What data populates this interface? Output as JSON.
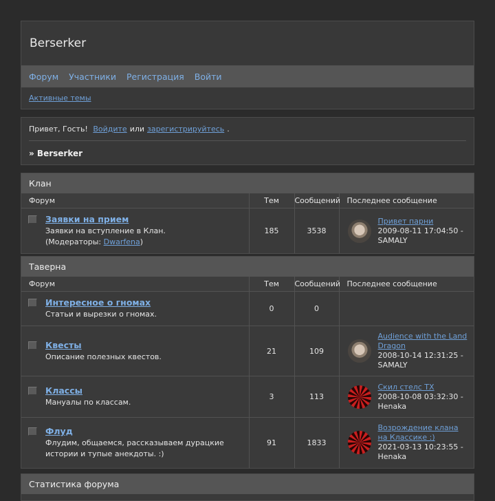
{
  "site": {
    "title": "Berserker",
    "nav": [
      "Форум",
      "Участники",
      "Регистрация",
      "Войти"
    ],
    "active_topics": "Активные темы"
  },
  "greeting": {
    "hello": "Привет, Гость!",
    "login": "Войдите",
    "or": "или",
    "register": "зарегистрируйтесь",
    "dot": ".",
    "breadcrumb": "» Berserker"
  },
  "columns": {
    "forum": "Форум",
    "topics": "Тем",
    "posts": "Сообщений",
    "last": "Последнее сообщение"
  },
  "categories": [
    {
      "title": "Клан",
      "forums": [
        {
          "name": "Заявки на прием",
          "desc": "Заявки на вступление в Клан.",
          "mods_label": "(Модераторы:",
          "mod": "Dwarfena",
          "mods_end": ")",
          "topics": "185",
          "posts": "3538",
          "last_title": "Привет парни",
          "last_date": "2009-08-11 17:04:50 -",
          "last_author": "SAMALY",
          "avatar": "photo"
        }
      ]
    },
    {
      "title": "Таверна",
      "forums": [
        {
          "name": "Интересное о гномах",
          "desc": "Статьи и вырезки о гномах.",
          "topics": "0",
          "posts": "0"
        },
        {
          "name": "Квесты",
          "desc": "Описание полезных квестов.",
          "topics": "21",
          "posts": "109",
          "last_title": "Audience with the Land Dragon",
          "last_date": "2008-10-14 12:31:25 -",
          "last_author": "SAMALY",
          "avatar": "photo"
        },
        {
          "name": "Классы",
          "desc": "Мануалы по классам.",
          "topics": "3",
          "posts": "113",
          "last_title": "Скил стелс ТХ",
          "last_date": "2008-10-08 03:32:30 -",
          "last_author": "Henaka",
          "avatar": "swirl"
        },
        {
          "name": "Флуд",
          "desc": "Флудим, общаемся, рассказываем дурацкие истории и тупые анекдоты. :)",
          "topics": "91",
          "posts": "1833",
          "last_title": "Возрождение клана на Классике :)",
          "last_date": "2021-03-13 10:23:55 -",
          "last_author": "Henaka",
          "avatar": "swirl"
        }
      ]
    }
  ],
  "stats": {
    "title": "Статистика форума"
  },
  "colors": {
    "background": "#2b2b2b",
    "panel": "#383838",
    "bar": "#555555",
    "link": "#7fb0e6"
  }
}
